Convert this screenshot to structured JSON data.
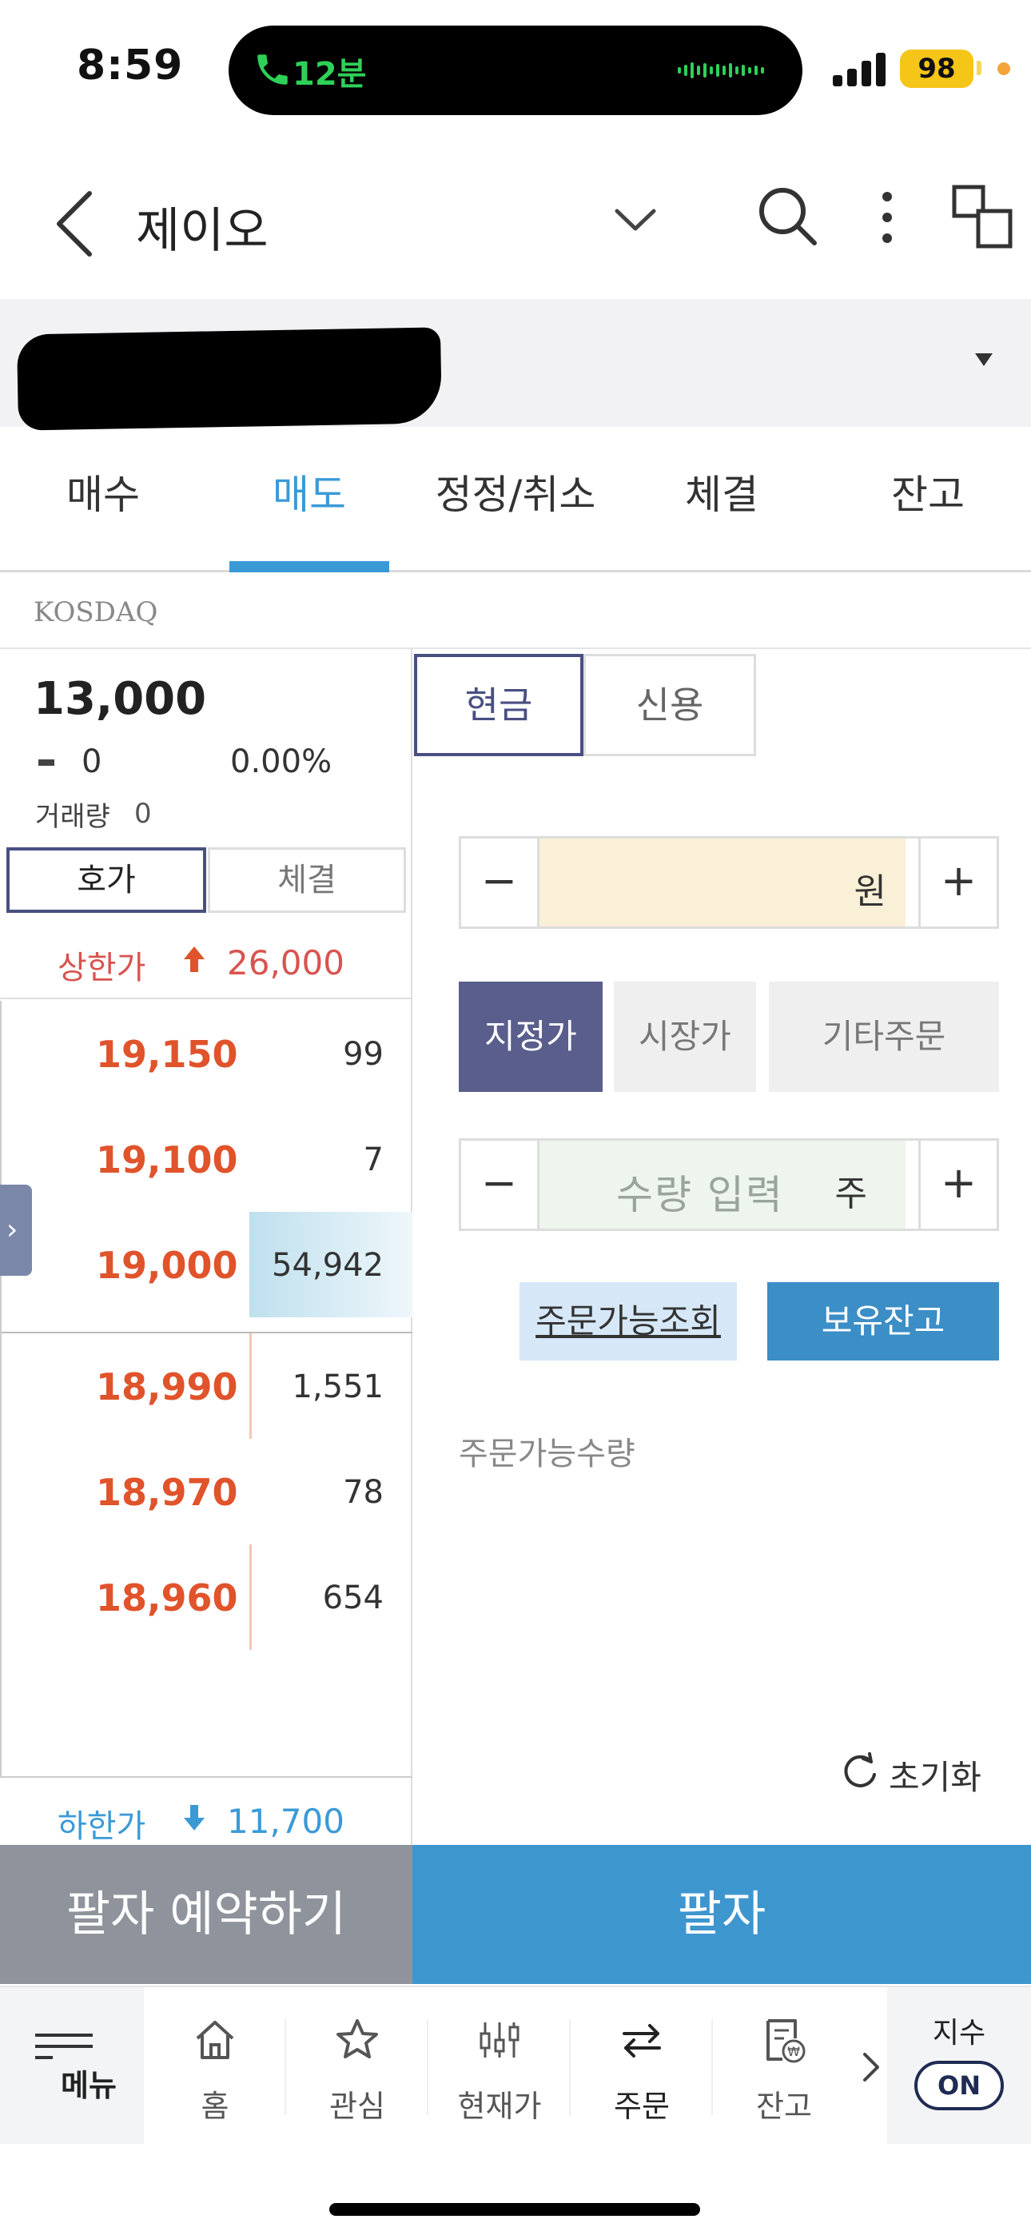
{
  "status_bar": {
    "time": "8:59",
    "call_duration": "12분",
    "battery": "98"
  },
  "header": {
    "title": "제이오"
  },
  "tabs": [
    {
      "label": "매수"
    },
    {
      "label": "매도"
    },
    {
      "label": "정정/취소"
    },
    {
      "label": "체결"
    },
    {
      "label": "잔고"
    }
  ],
  "active_tab": "매도",
  "market": "KOSDAQ",
  "quote": {
    "price": "13,000",
    "change": "0",
    "change_pct": "0.00%",
    "volume_label": "거래량",
    "volume": "0"
  },
  "left_segments": {
    "hoga": "호가",
    "chegyeol": "체결"
  },
  "upper_limit": {
    "label": "상한가",
    "value": "26,000"
  },
  "lower_limit": {
    "label": "하한가",
    "value": "11,700"
  },
  "order_book": {
    "asks": [
      {
        "price": "19,150",
        "qty": "99"
      },
      {
        "price": "19,100",
        "qty": "7"
      },
      {
        "price": "19,000",
        "qty": "54,942"
      }
    ],
    "bids": [
      {
        "price": "18,990",
        "qty": "1,551"
      },
      {
        "price": "18,970",
        "qty": "78"
      },
      {
        "price": "18,960",
        "qty": "654"
      }
    ]
  },
  "order_form": {
    "account_segments": {
      "cash": "현금",
      "credit": "신용"
    },
    "price_unit": "원",
    "minus": "−",
    "plus": "+",
    "order_types": {
      "limit": "지정가",
      "market": "시장가",
      "other": "기타주문"
    },
    "quantity_placeholder": "수량 입력",
    "quantity_unit": "주",
    "check_available_button": "주문가능조회",
    "holdings_button": "보유잔고",
    "available_qty_label": "주문가능수량",
    "reset_label": "초기화"
  },
  "actions": {
    "reserve_sell": "팔자 예약하기",
    "sell": "팔자"
  },
  "bottom_nav": {
    "menu": "메뉴",
    "items": [
      {
        "label": "홈",
        "icon": "home-icon"
      },
      {
        "label": "관심",
        "icon": "star-icon"
      },
      {
        "label": "현재가",
        "icon": "candlestick-icon"
      },
      {
        "label": "주문",
        "icon": "swap-arrows-icon"
      },
      {
        "label": "잔고",
        "icon": "receipt-won-icon"
      }
    ],
    "active": "주문",
    "index_label": "지수",
    "index_toggle": "ON"
  },
  "colors": {
    "accent_blue": "#3a9ad6",
    "ask_red": "#e0532b",
    "upper_red": "#d9534f",
    "navy": "#4a4f82",
    "reserve_gray": "#8e939c",
    "sell_blue": "#3e96cf"
  }
}
